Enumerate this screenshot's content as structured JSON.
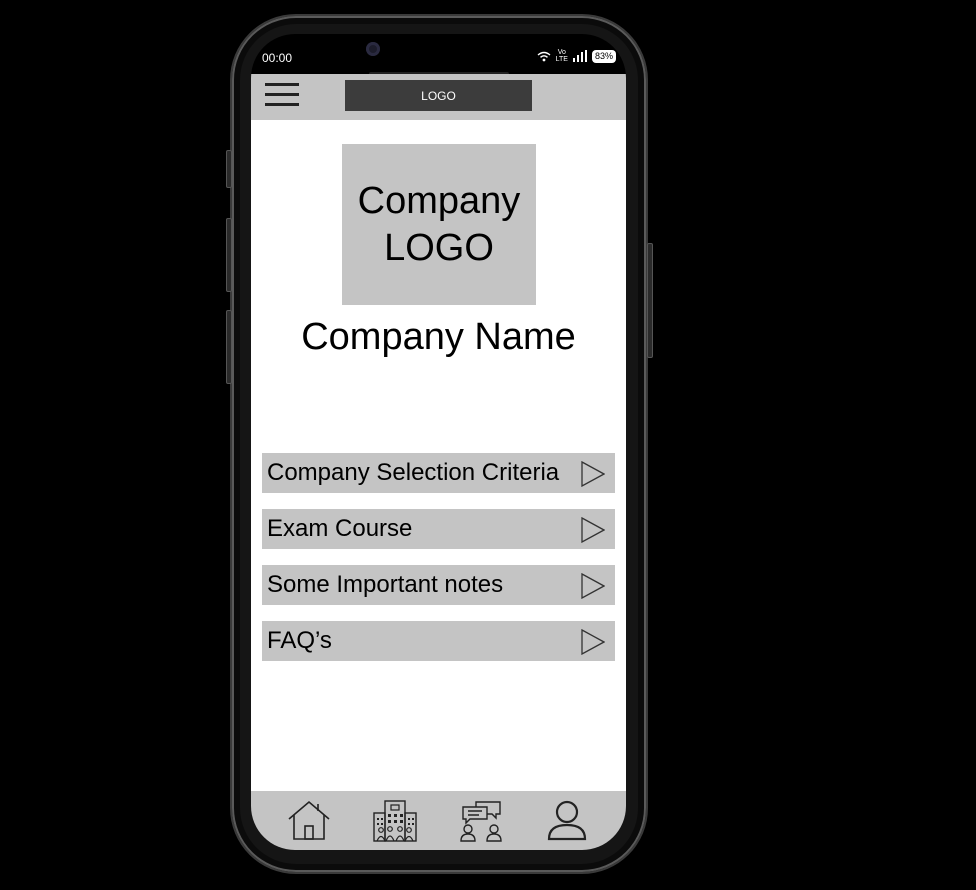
{
  "status_bar": {
    "time": "00:00",
    "network_top": "Vo",
    "network_bottom": "LTE",
    "battery": "83%",
    "icons": [
      "wifi-icon",
      "signal-icon",
      "battery-icon"
    ]
  },
  "header": {
    "menu_icon": "hamburger-icon",
    "logo_text": "LOGO"
  },
  "hero": {
    "logo_line1": "Company",
    "logo_line2": "LOGO",
    "company_name": "Company Name"
  },
  "menu": [
    {
      "label": "Company Selection Criteria",
      "icon": "play-arrow-icon"
    },
    {
      "label": "Exam Course",
      "icon": "play-arrow-icon"
    },
    {
      "label": "Some Important notes",
      "icon": "play-arrow-icon"
    },
    {
      "label": "FAQ’s",
      "icon": "play-arrow-icon"
    }
  ],
  "bottom_nav": {
    "items": [
      "home-icon",
      "company-building-icon",
      "discussion-icon",
      "profile-icon"
    ]
  }
}
